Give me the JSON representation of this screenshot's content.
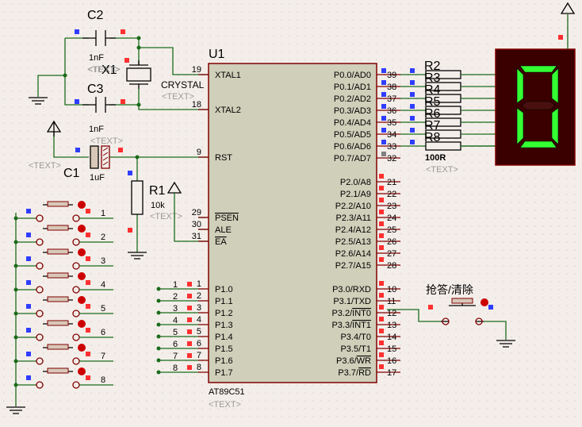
{
  "chip": {
    "ref": "U1",
    "part": "AT89C51",
    "text_placeholder": "<TEXT>",
    "left_pins": [
      {
        "num": "19",
        "name": "XTAL1"
      },
      {
        "num": "18",
        "name": "XTAL2"
      },
      {
        "num": "9",
        "name": "RST"
      },
      {
        "num": "29",
        "name": "PSEN"
      },
      {
        "num": "30",
        "name": "ALE"
      },
      {
        "num": "31",
        "name": "EA"
      },
      {
        "num": "1",
        "name": "P1.0"
      },
      {
        "num": "2",
        "name": "P1.1"
      },
      {
        "num": "3",
        "name": "P1.2"
      },
      {
        "num": "4",
        "name": "P1.3"
      },
      {
        "num": "5",
        "name": "P1.4"
      },
      {
        "num": "6",
        "name": "P1.5"
      },
      {
        "num": "7",
        "name": "P1.6"
      },
      {
        "num": "8",
        "name": "P1.7"
      }
    ],
    "right_pins": [
      {
        "num": "39",
        "name": "P0.0/AD0"
      },
      {
        "num": "38",
        "name": "P0.1/AD1"
      },
      {
        "num": "37",
        "name": "P0.2/AD2"
      },
      {
        "num": "36",
        "name": "P0.3/AD3"
      },
      {
        "num": "35",
        "name": "P0.4/AD4"
      },
      {
        "num": "34",
        "name": "P0.5/AD5"
      },
      {
        "num": "33",
        "name": "P0.6/AD6"
      },
      {
        "num": "32",
        "name": "P0.7/AD7"
      },
      {
        "num": "21",
        "name": "P2.0/A8"
      },
      {
        "num": "22",
        "name": "P2.1/A9"
      },
      {
        "num": "23",
        "name": "P2.2/A10"
      },
      {
        "num": "24",
        "name": "P2.3/A11"
      },
      {
        "num": "25",
        "name": "P2.4/A12"
      },
      {
        "num": "26",
        "name": "P2.5/A13"
      },
      {
        "num": "27",
        "name": "P2.6/A14"
      },
      {
        "num": "28",
        "name": "P2.7/A15"
      },
      {
        "num": "10",
        "name": "P3.0/RXD"
      },
      {
        "num": "11",
        "name": "P3.1/TXD"
      },
      {
        "num": "12",
        "name": "P3.2/INT0"
      },
      {
        "num": "13",
        "name": "P3.3/INT1"
      },
      {
        "num": "14",
        "name": "P3.4/T0"
      },
      {
        "num": "15",
        "name": "P3.5/T1"
      },
      {
        "num": "16",
        "name": "P3.6/WR"
      },
      {
        "num": "17",
        "name": "P3.7/RD"
      }
    ]
  },
  "components": {
    "c2": {
      "ref": "C2",
      "value": "1nF",
      "text": "<TEXT>"
    },
    "c3": {
      "ref": "C3",
      "value": "1nF",
      "text": "<TEXT>"
    },
    "c1": {
      "ref": "C1",
      "value": "1uF",
      "text": "<TEXT>"
    },
    "x1": {
      "ref": "X1",
      "value": "CRYSTAL",
      "text": "<TEXT>"
    },
    "r1": {
      "ref": "R1",
      "value": "10k",
      "text": "<TEXT>"
    },
    "resistors": [
      "R2",
      "R3",
      "R4",
      "R5",
      "R6",
      "R7",
      "R8"
    ],
    "resistor_value": "100R",
    "resistor_text": "<TEXT>",
    "answer_button": {
      "label": "抢答/清除"
    },
    "switch_numbers": [
      "1",
      "2",
      "3",
      "4",
      "5",
      "6",
      "7",
      "8"
    ]
  },
  "display": {
    "digit": "0",
    "segment_color": "#33ff33",
    "body_color": "#3a0000"
  },
  "colors": {
    "background": "#f4eeea",
    "wire": "#1a6b1a",
    "outline": "#800000",
    "chip_fill": "#cfcfba"
  }
}
